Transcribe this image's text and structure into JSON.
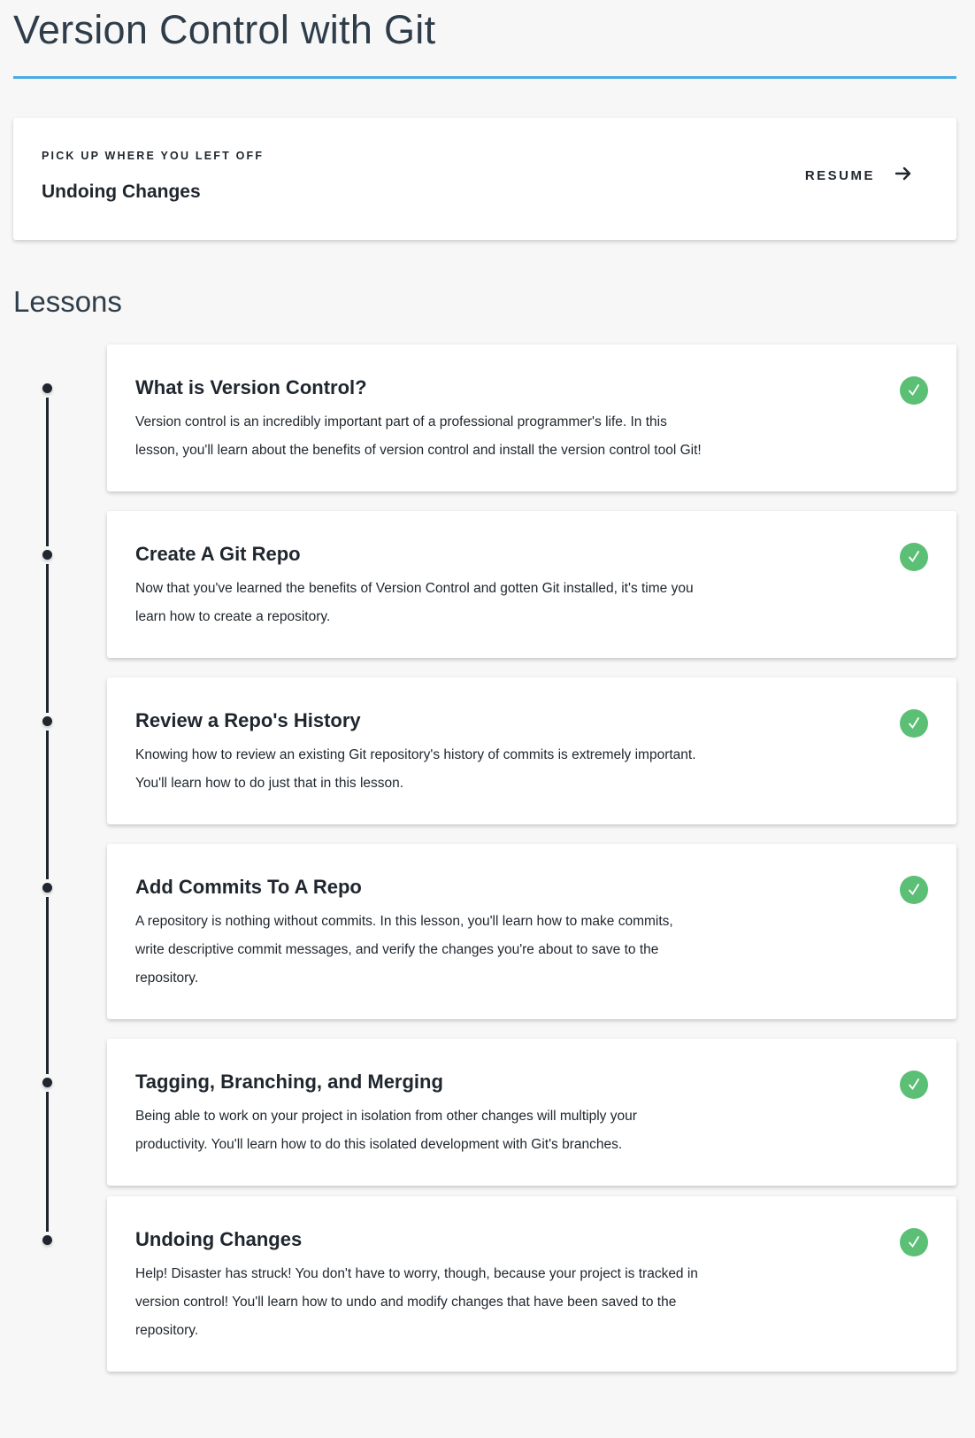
{
  "page_title": "Version Control with Git",
  "resume": {
    "eyebrow": "PICK UP WHERE YOU LEFT OFF",
    "lesson_title": "Undoing Changes",
    "button_label": "RESUME"
  },
  "lessons_heading": "Lessons",
  "colors": {
    "accent": "#4aabe0",
    "complete": "#5cbf76",
    "text": "#1f262e"
  },
  "lessons": [
    {
      "title": "What is Version Control?",
      "description": "Version control is an incredibly important part of a professional programmer's life. In this lesson, you'll learn about the benefits of version control and install the version control tool Git!",
      "status": "complete"
    },
    {
      "title": "Create A Git Repo",
      "description": "Now that you've learned the benefits of Version Control and gotten Git installed, it's time you learn how to create a repository.",
      "status": "complete"
    },
    {
      "title": "Review a Repo's History",
      "description": "Knowing how to review an existing Git repository's history of commits is extremely important. You'll learn how to do just that in this lesson.",
      "status": "complete"
    },
    {
      "title": "Add Commits To A Repo",
      "description": "A repository is nothing without commits. In this lesson, you'll learn how to make commits, write descriptive commit messages, and verify the changes you're about to save to the repository.",
      "status": "complete"
    },
    {
      "title": "Tagging, Branching, and Merging",
      "description": "Being able to work on your project in isolation from other changes will multiply your productivity. You'll learn how to do this isolated development with Git's branches.",
      "status": "complete"
    },
    {
      "title": "Undoing Changes",
      "description": "Help! Disaster has struck! You don't have to worry, though, because your project is tracked in version control! You'll learn how to undo and modify changes that have been saved to the repository.",
      "status": "complete"
    }
  ]
}
